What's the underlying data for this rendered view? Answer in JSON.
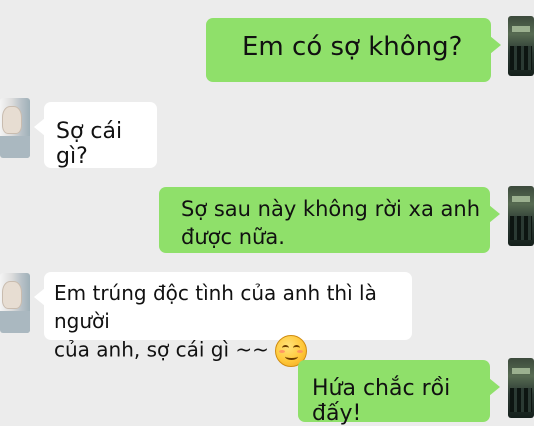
{
  "conversation": {
    "messages": [
      {
        "sender": "me",
        "text": "Em có sợ không?"
      },
      {
        "sender": "other",
        "text": "Sợ cái gì?"
      },
      {
        "sender": "me",
        "text": "Sợ sau này không rời xa anh\nđược nữa."
      },
      {
        "sender": "other",
        "text": "Em trúng độc tình của anh thì là người\ncủa anh, sợ cái gì ~~",
        "emoji": "smiling-blush-emoji"
      },
      {
        "sender": "me",
        "text": "Hứa chắc rồi đấy!"
      }
    ]
  },
  "colors": {
    "background": "#ececec",
    "sent_bubble": "#8fe06a",
    "received_bubble": "#ffffff",
    "text": "#111111"
  }
}
